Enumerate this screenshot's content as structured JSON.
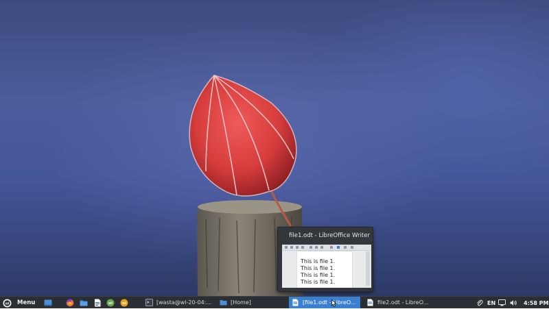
{
  "desktop": {
    "wallpaper": "frosted-red-lantern-on-post"
  },
  "taskbar": {
    "menu_label": "Menu",
    "launchers": [
      {
        "icon": "show-desktop-icon"
      },
      {
        "icon": "firefox-icon"
      },
      {
        "icon": "files-folder-icon"
      },
      {
        "icon": "writer-document-icon"
      },
      {
        "icon": "wasta-green-icon"
      },
      {
        "icon": "wasta-orange-icon"
      }
    ],
    "tasks": [
      {
        "label": "[wasta@wl-20-04:...",
        "icon": "terminal-icon",
        "active": false
      },
      {
        "label": "[Home]",
        "icon": "folder-icon",
        "active": false
      },
      {
        "label": "[file1.odt - LibreO...",
        "icon": "writer-document-icon",
        "active": true
      },
      {
        "label": "file2.odt - LibreO...",
        "icon": "writer-document-icon",
        "active": false
      }
    ],
    "tray": {
      "keyboard_layout": "EN",
      "clock": "4:58 PM"
    }
  },
  "preview": {
    "title": "file1.odt - LibreOffice Writer",
    "lines": [
      "This is file 1.",
      "This is file 1.",
      "This is file 1.",
      "This is file 1."
    ]
  },
  "colors": {
    "taskbar_bg": "#2b2e33",
    "active_task": "#3b7fd1",
    "accent_blue": "#4a90d9"
  }
}
